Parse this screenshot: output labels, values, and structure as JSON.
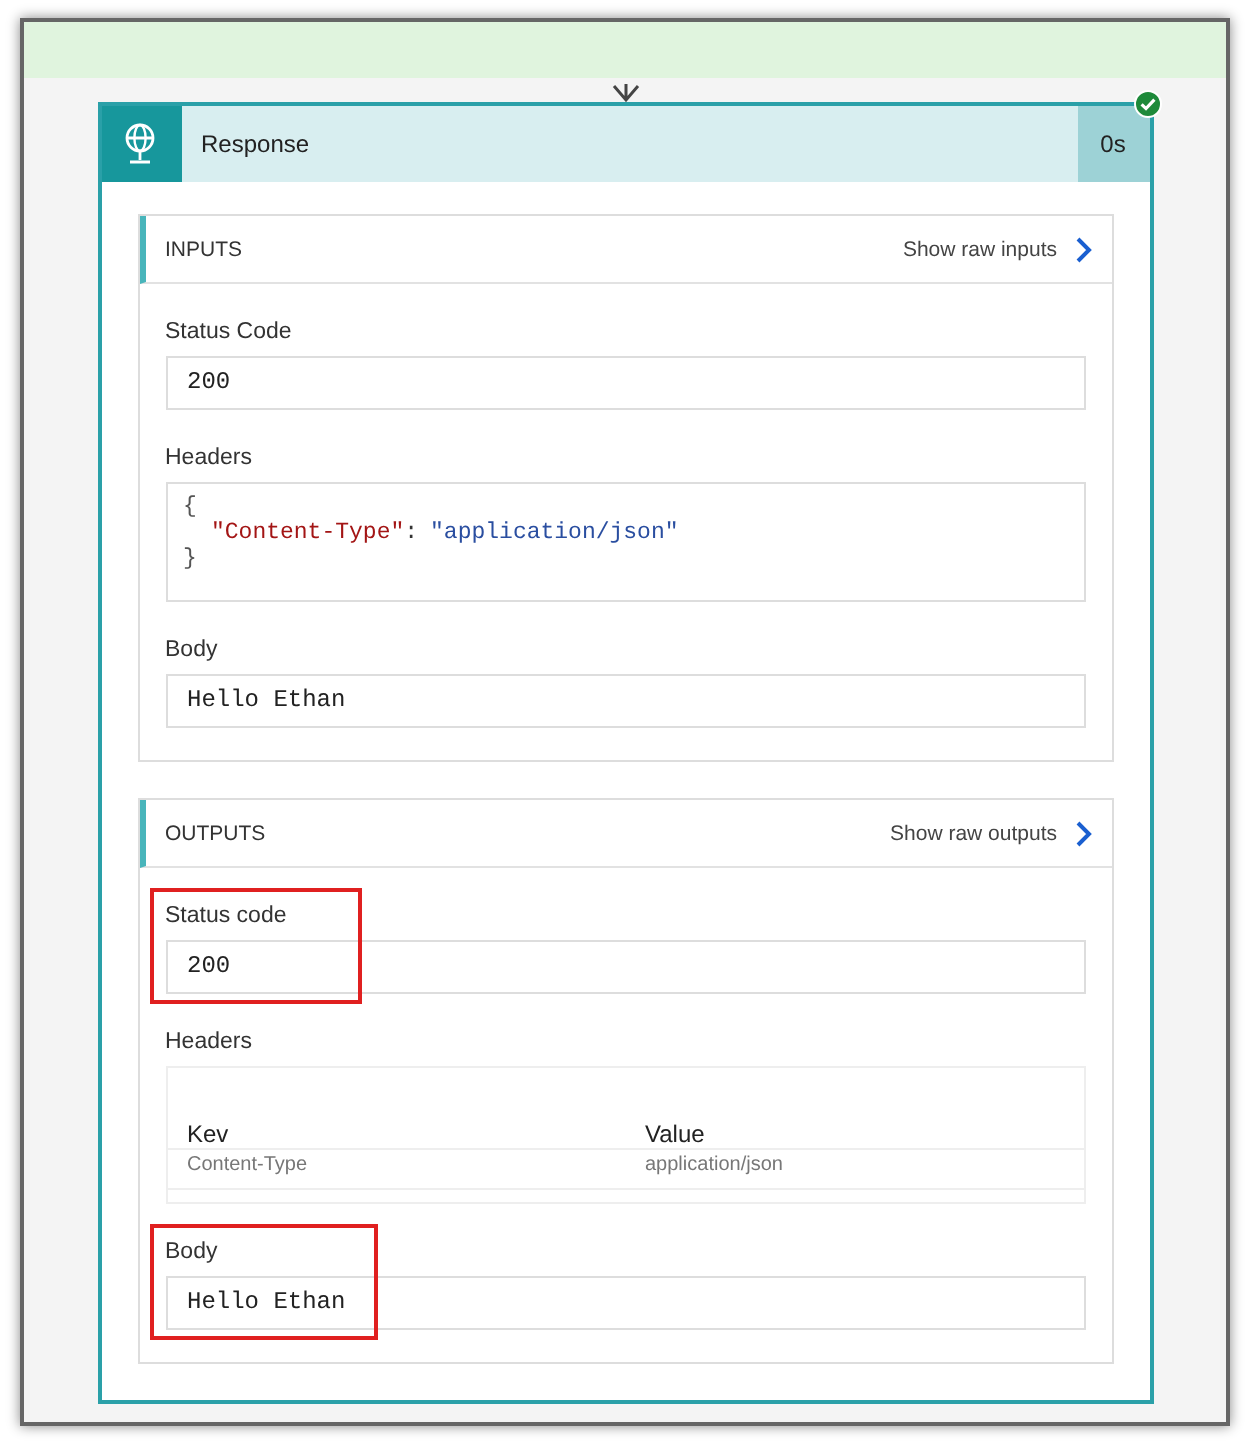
{
  "action": {
    "title": "Response",
    "duration": "0s",
    "succeeded": true
  },
  "sections": [
    {
      "title": "INPUTS",
      "link": "Show raw inputs",
      "fields": [
        {
          "kind": "text",
          "label": "Status Code",
          "value": "200",
          "highlighted": false
        },
        {
          "kind": "json",
          "label": "Headers",
          "open": "{",
          "entries": [
            {
              "key": "\"Content-Type\"",
              "separator": ":",
              "value": "\"application/json\""
            }
          ],
          "close": "}",
          "highlighted": false
        },
        {
          "kind": "text",
          "label": "Body",
          "value": "Hello Ethan",
          "highlighted": false
        }
      ]
    },
    {
      "title": "OUTPUTS",
      "link": "Show raw outputs",
      "fields": [
        {
          "kind": "text",
          "label": "Status code",
          "value": "200",
          "highlighted": true
        },
        {
          "kind": "table",
          "label": "Headers",
          "columns": [
            "Kev",
            "Value"
          ],
          "rows": [
            [
              "Content-Type",
              "application/json"
            ]
          ],
          "highlighted": false
        },
        {
          "kind": "text",
          "label": "Body",
          "value": "Hello Ethan",
          "highlighted": true
        }
      ]
    }
  ]
}
